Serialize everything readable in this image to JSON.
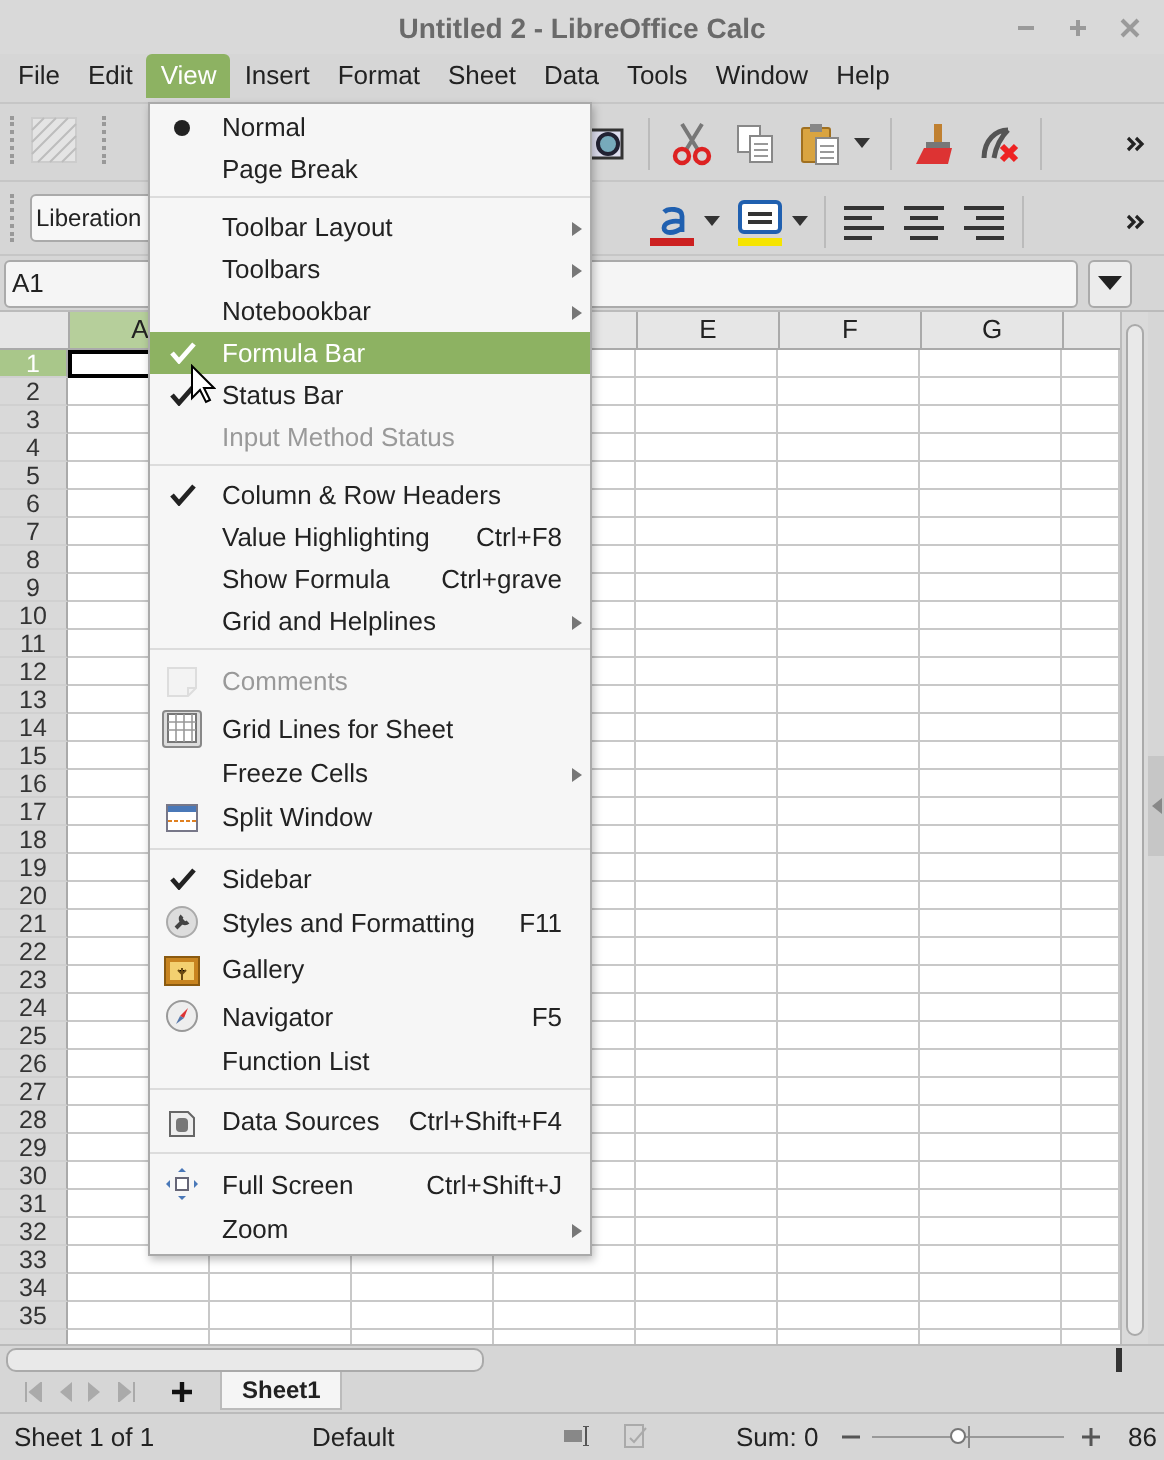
{
  "window": {
    "title": "Untitled 2 - LibreOffice Calc"
  },
  "menubar": [
    {
      "label": "File",
      "selected": false
    },
    {
      "label": "Edit",
      "selected": false
    },
    {
      "label": "View",
      "selected": true
    },
    {
      "label": "Insert",
      "selected": false
    },
    {
      "label": "Format",
      "selected": false
    },
    {
      "label": "Sheet",
      "selected": false
    },
    {
      "label": "Data",
      "selected": false
    },
    {
      "label": "Tools",
      "selected": false
    },
    {
      "label": "Window",
      "selected": false
    },
    {
      "label": "Help",
      "selected": false
    }
  ],
  "font_name": {
    "value": "Liberation"
  },
  "name_box": {
    "value": "A1"
  },
  "grid": {
    "columns": [
      {
        "label": "A",
        "selected": true
      },
      {
        "label": "E",
        "selected": false
      },
      {
        "label": "F",
        "selected": false
      },
      {
        "label": "G",
        "selected": false
      }
    ],
    "rows": [
      {
        "label": "1",
        "selected": true
      },
      {
        "label": "2",
        "selected": false
      },
      {
        "label": "3",
        "selected": false
      },
      {
        "label": "4",
        "selected": false
      },
      {
        "label": "5",
        "selected": false
      },
      {
        "label": "6",
        "selected": false
      },
      {
        "label": "7",
        "selected": false
      },
      {
        "label": "8",
        "selected": false
      },
      {
        "label": "9",
        "selected": false
      },
      {
        "label": "10",
        "selected": false
      },
      {
        "label": "11",
        "selected": false
      },
      {
        "label": "12",
        "selected": false
      },
      {
        "label": "13",
        "selected": false
      },
      {
        "label": "14",
        "selected": false
      },
      {
        "label": "15",
        "selected": false
      },
      {
        "label": "16",
        "selected": false
      },
      {
        "label": "17",
        "selected": false
      },
      {
        "label": "18",
        "selected": false
      },
      {
        "label": "19",
        "selected": false
      },
      {
        "label": "20",
        "selected": false
      },
      {
        "label": "21",
        "selected": false
      },
      {
        "label": "22",
        "selected": false
      },
      {
        "label": "23",
        "selected": false
      },
      {
        "label": "24",
        "selected": false
      },
      {
        "label": "25",
        "selected": false
      },
      {
        "label": "26",
        "selected": false
      },
      {
        "label": "27",
        "selected": false
      },
      {
        "label": "28",
        "selected": false
      },
      {
        "label": "29",
        "selected": false
      },
      {
        "label": "30",
        "selected": false
      },
      {
        "label": "31",
        "selected": false
      },
      {
        "label": "32",
        "selected": false
      },
      {
        "label": "33",
        "selected": false
      },
      {
        "label": "34",
        "selected": false
      },
      {
        "label": "35",
        "selected": false
      }
    ]
  },
  "menu": {
    "groups": [
      {
        "items": [
          {
            "label": "Normal",
            "kind": "radio",
            "checked": true,
            "disabled": false,
            "selected": false
          },
          {
            "label": "Page Break",
            "kind": "radio",
            "checked": false,
            "disabled": false,
            "selected": false
          }
        ]
      },
      {
        "items": [
          {
            "label": "Toolbar Layout",
            "kind": "plain",
            "submenu": true,
            "disabled": false,
            "selected": false
          },
          {
            "label": "Toolbars",
            "kind": "plain",
            "submenu": true,
            "disabled": false,
            "selected": false
          },
          {
            "label": "Notebookbar",
            "kind": "plain",
            "submenu": true,
            "disabled": false,
            "selected": false
          },
          {
            "label": "Formula Bar",
            "kind": "check",
            "checked": true,
            "disabled": false,
            "selected": true
          },
          {
            "label": "Status Bar",
            "kind": "check",
            "checked": true,
            "disabled": false,
            "selected": false
          },
          {
            "label": "Input Method Status",
            "kind": "check",
            "checked": false,
            "disabled": true,
            "selected": false
          }
        ]
      },
      {
        "items": [
          {
            "label": "Column & Row Headers",
            "kind": "check",
            "checked": true,
            "disabled": false,
            "selected": false
          },
          {
            "label": "Value Highlighting",
            "shortcut": "Ctrl+F8",
            "kind": "check",
            "checked": false,
            "disabled": false,
            "selected": false
          },
          {
            "label": "Show Formula",
            "shortcut": "Ctrl+grave",
            "kind": "check",
            "checked": false,
            "disabled": false,
            "selected": false
          },
          {
            "label": "Grid and Helplines",
            "kind": "plain",
            "submenu": true,
            "disabled": false,
            "selected": false
          }
        ]
      },
      {
        "items": [
          {
            "label": "Comments",
            "kind": "icon",
            "checked": false,
            "disabled": true,
            "selected": false
          },
          {
            "label": "Grid Lines for Sheet",
            "kind": "icon",
            "checked": true,
            "disabled": false,
            "selected": false
          },
          {
            "label": "Freeze Cells",
            "kind": "plain",
            "submenu": true,
            "disabled": false,
            "selected": false
          },
          {
            "label": "Split Window",
            "kind": "icon",
            "checked": false,
            "disabled": false,
            "selected": false
          }
        ]
      },
      {
        "items": [
          {
            "label": "Sidebar",
            "kind": "check",
            "checked": true,
            "disabled": false,
            "selected": false
          },
          {
            "label": "Styles and Formatting",
            "shortcut": "F11",
            "kind": "icon",
            "checked": false,
            "disabled": false,
            "selected": false
          },
          {
            "label": "Gallery",
            "kind": "icon",
            "checked": false,
            "disabled": false,
            "selected": false
          },
          {
            "label": "Navigator",
            "shortcut": "F5",
            "kind": "icon",
            "checked": false,
            "disabled": false,
            "selected": false
          },
          {
            "label": "Function List",
            "kind": "plain",
            "disabled": false,
            "selected": false
          }
        ]
      },
      {
        "items": [
          {
            "label": "Data Sources",
            "shortcut": "Ctrl+Shift+F4",
            "kind": "icon",
            "checked": false,
            "disabled": false,
            "selected": false
          }
        ]
      },
      {
        "items": [
          {
            "label": "Full Screen",
            "shortcut": "Ctrl+Shift+J",
            "kind": "icon",
            "checked": false,
            "disabled": false,
            "selected": false
          },
          {
            "label": "Zoom",
            "kind": "plain",
            "submenu": true,
            "disabled": false,
            "selected": false
          }
        ]
      }
    ]
  },
  "sheet_tabs": [
    {
      "label": "Sheet1",
      "selected": true
    }
  ],
  "status_bar": {
    "sheet": "Sheet 1 of 1",
    "style": "Default",
    "sum": "Sum: 0",
    "zoom": {
      "level": 0.45,
      "reading": "86"
    }
  }
}
